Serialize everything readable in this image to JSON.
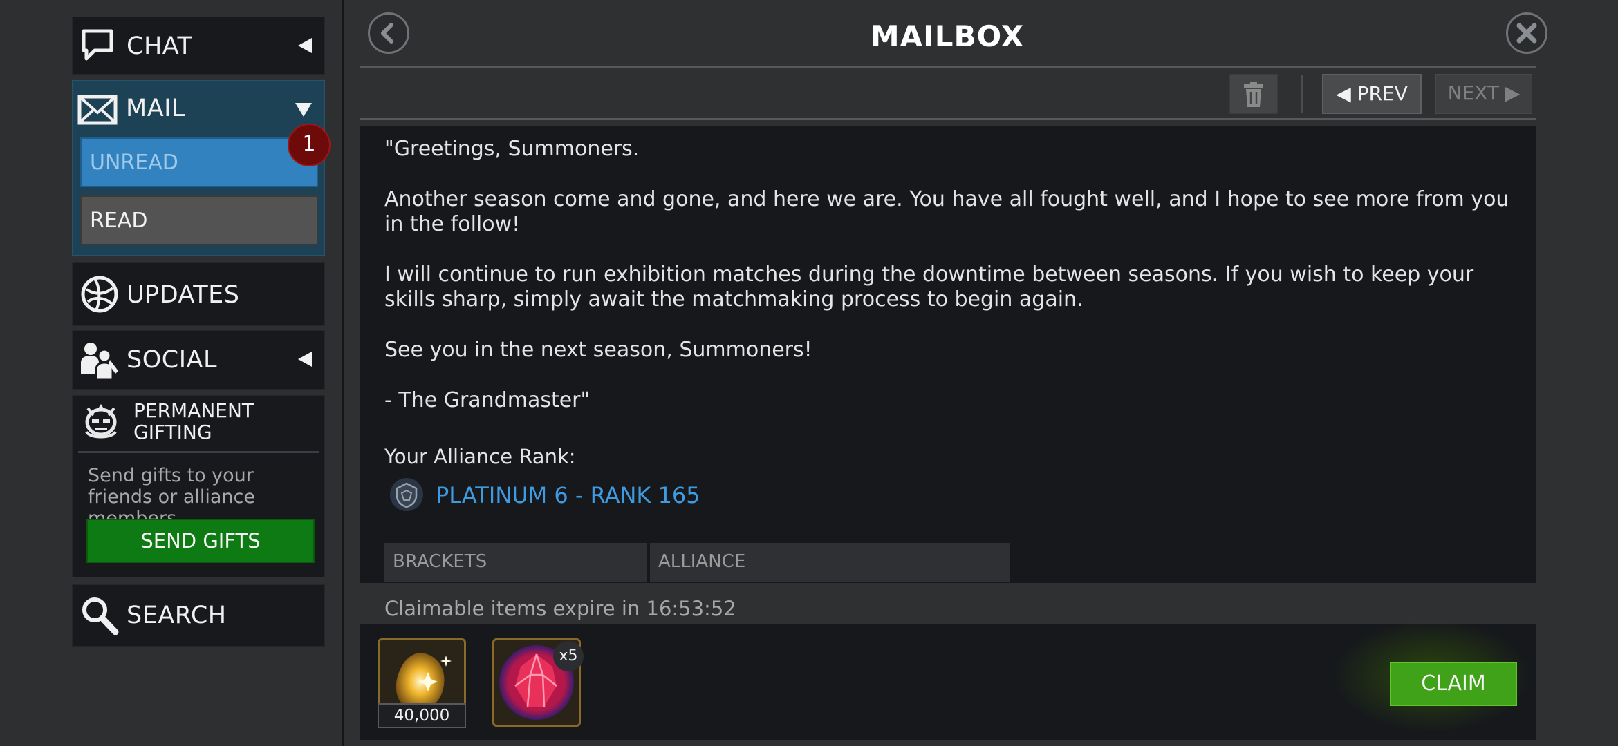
{
  "sidebar": {
    "chat": {
      "label": "CHAT"
    },
    "mail": {
      "label": "MAIL",
      "unread_label": "UNREAD",
      "unread_count": "1",
      "read_label": "READ"
    },
    "updates": {
      "label": "UPDATES"
    },
    "social": {
      "label": "SOCIAL"
    },
    "gifting": {
      "title": "PERMANENT GIFTING",
      "description": "Send gifts to your friends or alliance members.",
      "button_label": "SEND GIFTS"
    },
    "search": {
      "label": "SEARCH"
    }
  },
  "header": {
    "title": "MAILBOX",
    "back_icon": "back-arrow-icon",
    "close_icon": "close-icon"
  },
  "toolbar": {
    "delete_icon": "trash-icon",
    "prev_label": "◀ PREV",
    "next_label": "NEXT ▶"
  },
  "message": {
    "paragraphs": [
      "\"Greetings, Summoners.",
      "Another season come and gone, and here we are. You have all fought well, and I hope to see more from you in the follow!",
      "I will continue to run exhibition matches during the downtime between seasons. If you wish to keep your skills sharp, simply await the matchmaking process to begin again.",
      "See you in the next season, Summoners!",
      "- The Grandmaster\""
    ],
    "rank_label": "Your Alliance Rank:",
    "rank_value": "PLATINUM 6 - RANK 165",
    "table_headers": [
      "BRACKETS",
      "ALLIANCE"
    ]
  },
  "rewards": {
    "expire_text": "Claimable items expire in 16:53:52",
    "items": [
      {
        "icon": "gold-crystal-icon",
        "count": "40,000"
      },
      {
        "icon": "red-crystal-icon",
        "multiplier": "x5"
      }
    ],
    "claim_label": "CLAIM"
  },
  "colors": {
    "accent_blue": "#3f9be0",
    "unread_blue": "#3282c0",
    "send_green": "#0d7a13",
    "claim_green": "#3fa218",
    "badge_red": "#6d0b0b"
  }
}
